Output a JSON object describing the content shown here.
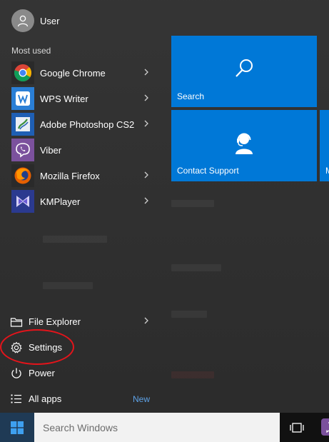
{
  "user": {
    "name": "User"
  },
  "most_used": {
    "label": "Most used",
    "apps": [
      {
        "label": "Google Chrome",
        "icon": "chrome-icon",
        "has_submenu": true
      },
      {
        "label": "WPS Writer",
        "icon": "wps-writer-icon",
        "has_submenu": true
      },
      {
        "label": "Adobe Photoshop CS2",
        "icon": "photoshop-icon",
        "has_submenu": true
      },
      {
        "label": "Viber",
        "icon": "viber-icon",
        "has_submenu": false
      },
      {
        "label": "Mozilla Firefox",
        "icon": "firefox-icon",
        "has_submenu": true
      },
      {
        "label": "KMPlayer",
        "icon": "kmplayer-icon",
        "has_submenu": true
      }
    ]
  },
  "bottom": {
    "file_explorer": "File Explorer",
    "settings": "Settings",
    "power": "Power",
    "all_apps": "All apps",
    "new_badge": "New"
  },
  "tiles": {
    "search": "Search",
    "contact_support": "Contact Support",
    "partial": "M"
  },
  "taskbar": {
    "search_placeholder": "Search Windows"
  },
  "colors": {
    "accent": "#0078d7",
    "menu_bg": "#2f2f2f",
    "highlight_ring": "#e4141b",
    "new_badge": "#5ea2e6"
  }
}
